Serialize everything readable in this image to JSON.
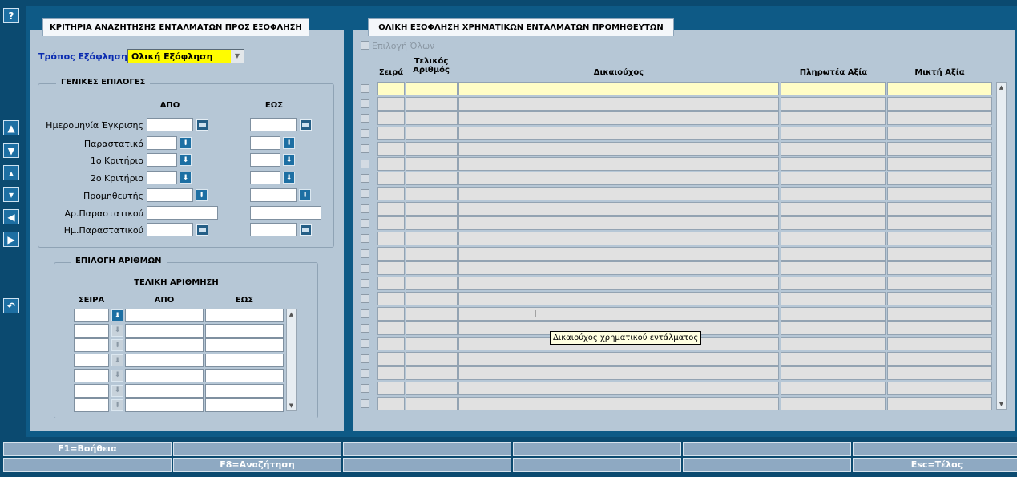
{
  "colors": {
    "background": "#0b4a70",
    "panel": "#b6c7d6",
    "highlight_field": "#fffc00",
    "active_row": "#fffdc6"
  },
  "toolbar": {
    "help_label": "?",
    "side_buttons": [
      "first-record",
      "next-record",
      "previous-block",
      "next-block",
      "left",
      "right",
      "undo"
    ]
  },
  "left_panel": {
    "tab_title": "ΚΡΙΤΗΡΙΑ ΑΝΑΖΗΤΗΣΗΣ ΕΝΤΑΛΜΑΤΩΝ ΠΡΟΣ ΕΞΟΦΛΗΣΗ",
    "payment_mode_label": "Τρόπος Εξόφλησης",
    "payment_mode_value": "Ολική Εξόφληση",
    "general": {
      "legend": "ΓΕΝΙΚΕΣ ΕΠΙΛΟΓΕΣ",
      "from_header": "ΑΠΟ",
      "to_header": "ΕΩΣ",
      "rows": {
        "approval_date": "Ημερομηνία Έγκρισης",
        "voucher": "Παραστατικό",
        "criterion1": "1ο Κριτήριο",
        "criterion2": "2ο Κριτήριο",
        "supplier": "Προμηθευτής",
        "voucher_no": "Αρ.Παραστατικού",
        "voucher_date": "Ημ.Παραστατικού"
      }
    },
    "numbering": {
      "legend": "ΕΠΙΛΟΓΗ ΑΡΙΘΜΩΝ",
      "subtitle": "ΤΕΛΙΚΗ ΑΡΙΘΜΗΣΗ",
      "col_series": "ΣΕΙΡΑ",
      "col_from": "ΑΠΟ",
      "col_to": "ΕΩΣ"
    }
  },
  "right_panel": {
    "tab_title": "ΟΛΙΚΗ ΕΞΟΦΛΗΣΗ ΧΡΗΜΑΤΙΚΩΝ ΕΝΤΑΛΜΑΤΩΝ ΠΡΟΜΗΘΕΥΤΩΝ",
    "select_all_label": "Επιλογή Όλων",
    "columns": {
      "series": "Σειρά",
      "final_no": "Τελικός Αριθμός",
      "beneficiary": "Δικαιούχος",
      "payable": "Πληρωτέα Αξία",
      "gross": "Μικτή Αξία"
    },
    "tooltip": "Δικαιούχος χρηματικού εντάλματος"
  },
  "function_keys": {
    "row1": [
      "F1=Βοήθεια",
      "",
      "",
      "",
      "",
      ""
    ],
    "row2": [
      "",
      "F8=Αναζήτηση",
      "",
      "",
      "",
      "Esc=Τέλος"
    ]
  }
}
